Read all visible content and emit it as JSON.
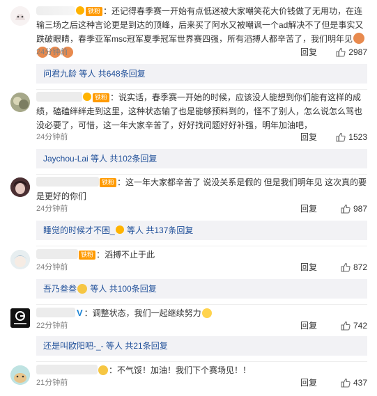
{
  "comments": [
    {
      "text": "：还记得春季赛一开始有点低迷被大家嘲笑花大价钱做了无用功，在连输三场之后这种言论更是到达的顶峰，后来买了阿水又被嘲讽一个ad解决不了但是事实又跌破眼睛，春季亚军msc冠军夏季冠军世界赛四强，所有滔搏人都辛苦了，我们明年见",
      "badge": "铁粉",
      "time": "24分钟前",
      "reply_label": "回复",
      "likes": "2987",
      "thread": {
        "name": "问君九龄",
        "mid": " 等人 ",
        "count": "共648条回复"
      }
    },
    {
      "text": "：说实话，春季赛一开始的时候，应该没人能想到你们能有这样的成绩，磕磕绊绊走到这里，这种状态输了也是能够预料到的，怪不了别人，怎么说怎么骂也没必要了，可惜，这一年大家辛苦了，好好找问题好好补强，明年加油吧，",
      "badge": "铁粉",
      "time": "24分钟前",
      "reply_label": "回复",
      "likes": "1523",
      "thread": {
        "name": "Jaychou-Lai",
        "mid": " 等人 ",
        "count": "共102条回复"
      }
    },
    {
      "text": "：这一年大家都辛苦了 说没关系是假的 但是我们明年见 这次真的要是更好的你们",
      "badge": "铁粉",
      "time": "24分钟前",
      "reply_label": "回复",
      "likes": "987",
      "thread": {
        "name": "睡觉的时候才不困_",
        "mid": " 等人 ",
        "count": "共137条回复"
      }
    },
    {
      "text": "：滔搏不止于此",
      "badge": "铁粉",
      "time": "24分钟前",
      "reply_label": "回复",
      "likes": "872",
      "thread": {
        "name": "吾乃叁叁",
        "mid": " 等人 ",
        "count": "共100条回复"
      }
    },
    {
      "text": "：调整状态，我们一起继续努力",
      "badge": "V",
      "time": "22分钟前",
      "reply_label": "回复",
      "likes": "742",
      "thread": {
        "name": "还是叫欧阳吧-_-",
        "mid": " 等人 ",
        "count": "共21条回复"
      }
    },
    {
      "text": "：不气馁！加油！我们下个赛场见！！",
      "badge": "",
      "time": "21分钟前",
      "reply_label": "回复",
      "likes": "437"
    }
  ],
  "colors": {
    "link": "#1f4f99",
    "badge": "#ff9a00",
    "reply_bg": "#f2f2f5",
    "meta": "#808080"
  },
  "icons": {
    "like": "thumbs-up-icon"
  }
}
